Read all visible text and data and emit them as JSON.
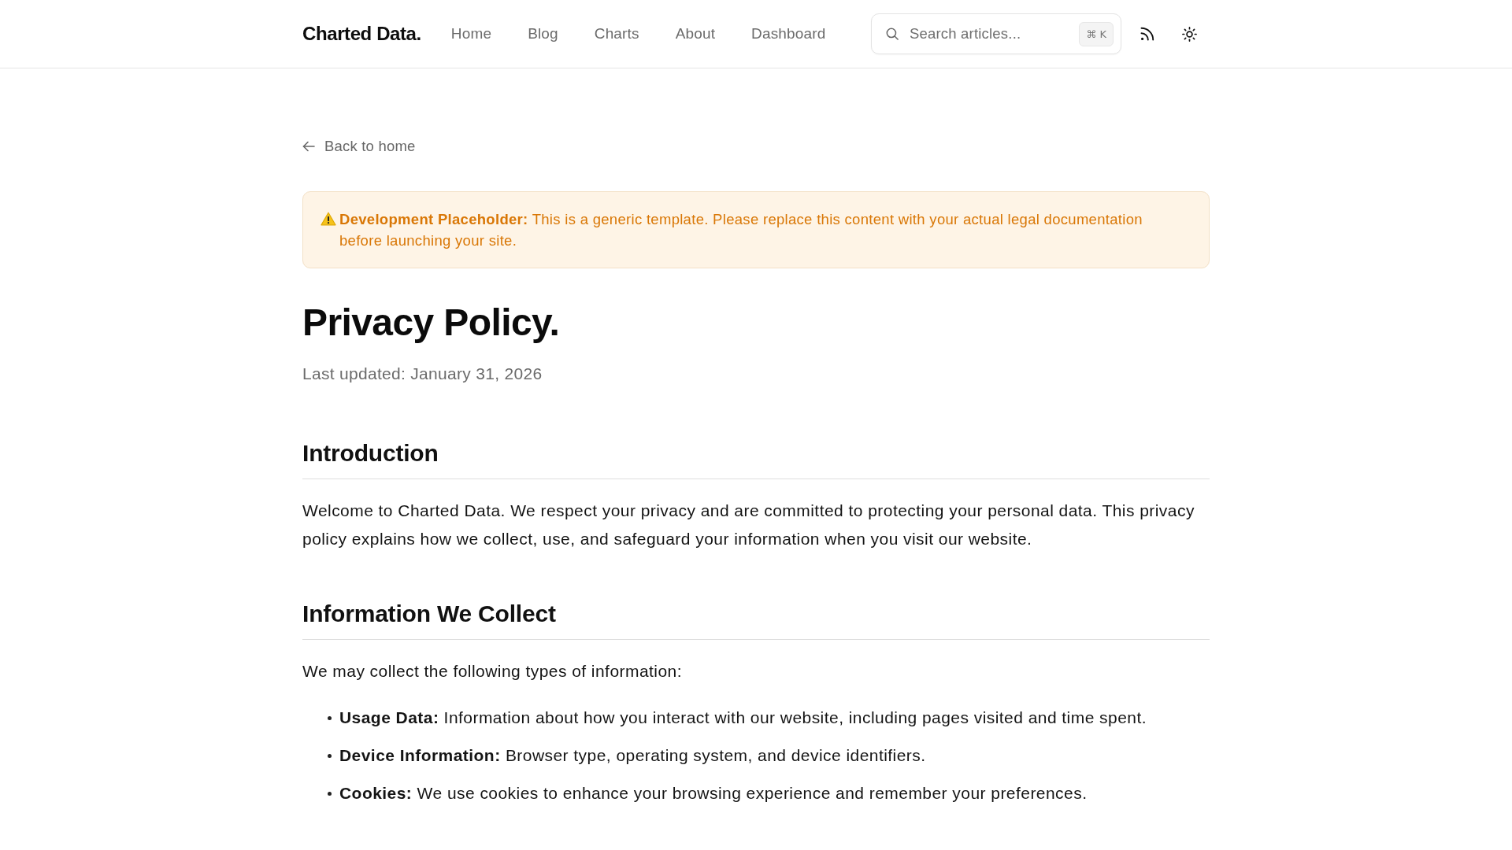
{
  "header": {
    "logo": "Charted Data.",
    "nav_links": [
      "Home",
      "Blog",
      "Charts",
      "About",
      "Dashboard"
    ],
    "search": {
      "placeholder": "Search articles...",
      "shortcut": "⌘ K"
    }
  },
  "back_link": "Back to home",
  "notice": {
    "kind": "warning",
    "text": "**Development Placeholder:** This is a generic template. Please replace this content with your actual legal documentation before launching your site."
  },
  "title": "Privacy Policy.",
  "last_updated": "Last updated: January 31, 2026",
  "sections": [
    {
      "heading": "Introduction",
      "paragraphs": [
        "Welcome to Charted Data. We respect your privacy and are committed to protecting your personal data. This privacy policy explains how we collect, use, and safeguard your information when you visit our website."
      ]
    },
    {
      "heading": "Information We Collect",
      "paragraphs": [
        "We may collect the following types of information:"
      ],
      "list": [
        "**Usage Data:** Information about how you interact with our website, including pages visited and time spent.",
        "**Device Information:** Browser type, operating system, and device identifiers.",
        "**Cookies:** We use cookies to enhance your browsing experience and remember your preferences."
      ]
    }
  ]
}
